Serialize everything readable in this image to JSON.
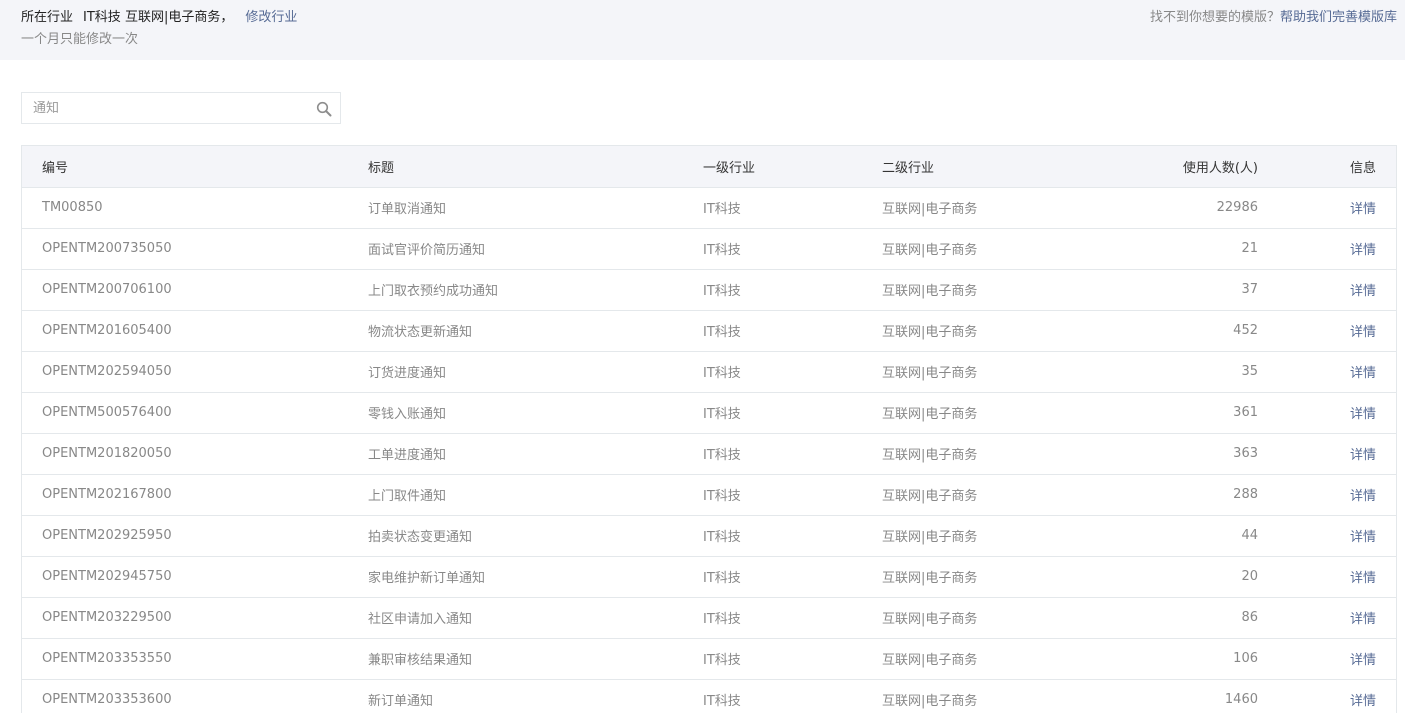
{
  "header": {
    "industry_label": "所在行业",
    "industry_primary": "IT科技",
    "industry_secondary": "互联网|电子商务，",
    "modify_link": "修改行业",
    "limit_note": "一个月只能修改一次",
    "help_text": "找不到你想要的模版？",
    "help_link": "帮助我们完善模版库"
  },
  "search": {
    "value": "",
    "placeholder": "通知",
    "icon": "search-icon"
  },
  "table": {
    "columns": {
      "id": "编号",
      "title": "标题",
      "level1": "一级行业",
      "level2": "二级行业",
      "users": "使用人数(人)",
      "info": "信息"
    },
    "rows": [
      {
        "id": "TM00850",
        "title": "订单取消通知",
        "level1": "IT科技",
        "level2": "互联网|电子商务",
        "users": "22986",
        "info": "详情"
      },
      {
        "id": "OPENTM200735050",
        "title": "面试官评价简历通知",
        "level1": "IT科技",
        "level2": "互联网|电子商务",
        "users": "21",
        "info": "详情"
      },
      {
        "id": "OPENTM200706100",
        "title": "上门取衣预约成功通知",
        "level1": "IT科技",
        "level2": "互联网|电子商务",
        "users": "37",
        "info": "详情"
      },
      {
        "id": "OPENTM201605400",
        "title": "物流状态更新通知",
        "level1": "IT科技",
        "level2": "互联网|电子商务",
        "users": "452",
        "info": "详情"
      },
      {
        "id": "OPENTM202594050",
        "title": "订货进度通知",
        "level1": "IT科技",
        "level2": "互联网|电子商务",
        "users": "35",
        "info": "详情"
      },
      {
        "id": "OPENTM500576400",
        "title": "零钱入账通知",
        "level1": "IT科技",
        "level2": "互联网|电子商务",
        "users": "361",
        "info": "详情"
      },
      {
        "id": "OPENTM201820050",
        "title": "工单进度通知",
        "level1": "IT科技",
        "level2": "互联网|电子商务",
        "users": "363",
        "info": "详情"
      },
      {
        "id": "OPENTM202167800",
        "title": "上门取件通知",
        "level1": "IT科技",
        "level2": "互联网|电子商务",
        "users": "288",
        "info": "详情"
      },
      {
        "id": "OPENTM202925950",
        "title": "拍卖状态变更通知",
        "level1": "IT科技",
        "level2": "互联网|电子商务",
        "users": "44",
        "info": "详情"
      },
      {
        "id": "OPENTM202945750",
        "title": "家电维护新订单通知",
        "level1": "IT科技",
        "level2": "互联网|电子商务",
        "users": "20",
        "info": "详情"
      },
      {
        "id": "OPENTM203229500",
        "title": "社区申请加入通知",
        "level1": "IT科技",
        "level2": "互联网|电子商务",
        "users": "86",
        "info": "详情"
      },
      {
        "id": "OPENTM203353550",
        "title": "兼职审核结果通知",
        "level1": "IT科技",
        "level2": "互联网|电子商务",
        "users": "106",
        "info": "详情"
      },
      {
        "id": "OPENTM203353600",
        "title": "新订单通知",
        "level1": "IT科技",
        "level2": "互联网|电子商务",
        "users": "1460",
        "info": "详情"
      }
    ]
  }
}
